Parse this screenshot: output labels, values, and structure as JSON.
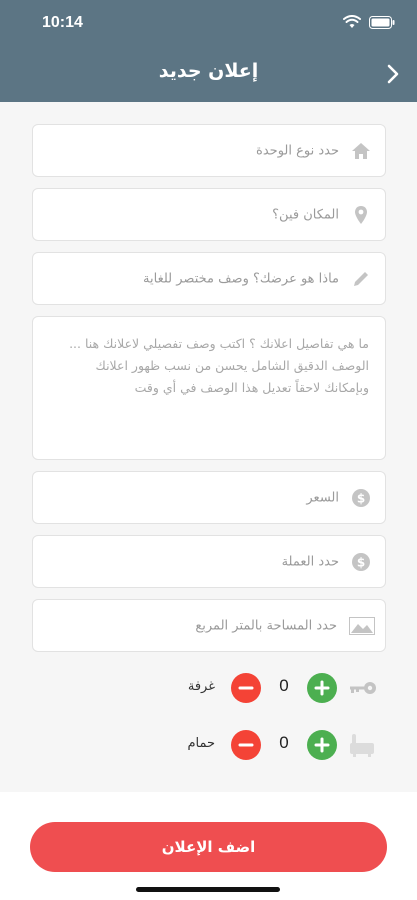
{
  "status_bar": {
    "time": "10:14",
    "icons": [
      "wifi-icon",
      "battery-icon"
    ]
  },
  "header": {
    "title": "إعلان جديد",
    "back_icon": "chevron-right-icon"
  },
  "form": {
    "unit_type": {
      "placeholder": "حدد نوع الوحدة",
      "icon": "home-icon"
    },
    "location": {
      "placeholder": "المكان فين؟",
      "icon": "location-pin-icon"
    },
    "short_desc": {
      "placeholder": "ماذا هو عرضك؟ وصف مختصر للغاية",
      "icon": "pencil-icon"
    },
    "details": {
      "placeholder": "ما هي تفاصيل اعلانك ؟ اكتب وصف تفصيلي لاعلانك هنا ... الوصف الدقيق الشامل يحسن من نسب ظهور اعلانك وبإمكانك لاحقاً تعديل هذا الوصف في أي وقت"
    },
    "price": {
      "placeholder": "السعر",
      "icon": "dollar-icon"
    },
    "currency": {
      "placeholder": "حدد العملة",
      "icon": "dollar-icon"
    },
    "area": {
      "placeholder": "حدد المساحة بالمتر المربع",
      "icon": "area-icon"
    }
  },
  "counters": {
    "rooms": {
      "label": "غرفة",
      "value": "0",
      "icon": "key-icon"
    },
    "bathrooms": {
      "label": "حمام",
      "value": "0",
      "icon": "bathtub-icon"
    }
  },
  "submit": {
    "label": "اضف الإعلان"
  },
  "colors": {
    "header": "#5c7584",
    "plus": "#4caf50",
    "minus": "#f44336",
    "submit": "#ef4e50"
  }
}
